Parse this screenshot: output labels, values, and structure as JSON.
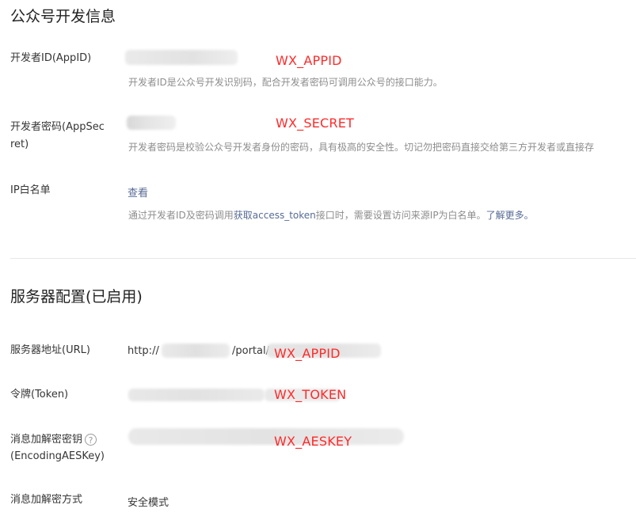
{
  "dev_info": {
    "title": "公众号开发信息",
    "appid": {
      "label": "开发者ID(AppID)",
      "annotation": "WX_APPID",
      "desc": "开发者ID是公众号开发识别码，配合开发者密码可调用公众号的接口能力。"
    },
    "secret": {
      "label_line1": "开发者密码(AppSec",
      "label_line2": "ret)",
      "annotation": "WX_SECRET",
      "desc": "开发者密码是校验公众号开发者身份的密码，具有极高的安全性。切记勿把密码直接交给第三方开发者或直接存"
    },
    "ip_whitelist": {
      "label": "IP白名单",
      "view_link": "查看",
      "desc_prefix": "通过开发者ID及密码调用",
      "desc_link1": "获取access_token",
      "desc_middle": "接口时，需要设置访问来源IP为白名单。",
      "desc_link2": "了解更多。"
    }
  },
  "server_config": {
    "title": "服务器配置(已启用)",
    "url": {
      "label": "服务器地址(URL)",
      "prefix": "http://",
      "middle": "/portal/",
      "annotation": "WX_APPID"
    },
    "token": {
      "label": "令牌(Token)",
      "annotation": "WX_TOKEN"
    },
    "aeskey": {
      "label_line1": "消息加解密密钥",
      "label_line2": "(EncodingAESKey)",
      "help": "?",
      "annotation": "WX_AESKEY"
    },
    "encrypt_mode": {
      "label": "消息加解密方式",
      "value": "安全模式"
    }
  },
  "colors": {
    "annotation": "#ff2a2a",
    "link": "#576b95",
    "description": "#8d8d8d",
    "redaction": "#e4e4e4"
  }
}
